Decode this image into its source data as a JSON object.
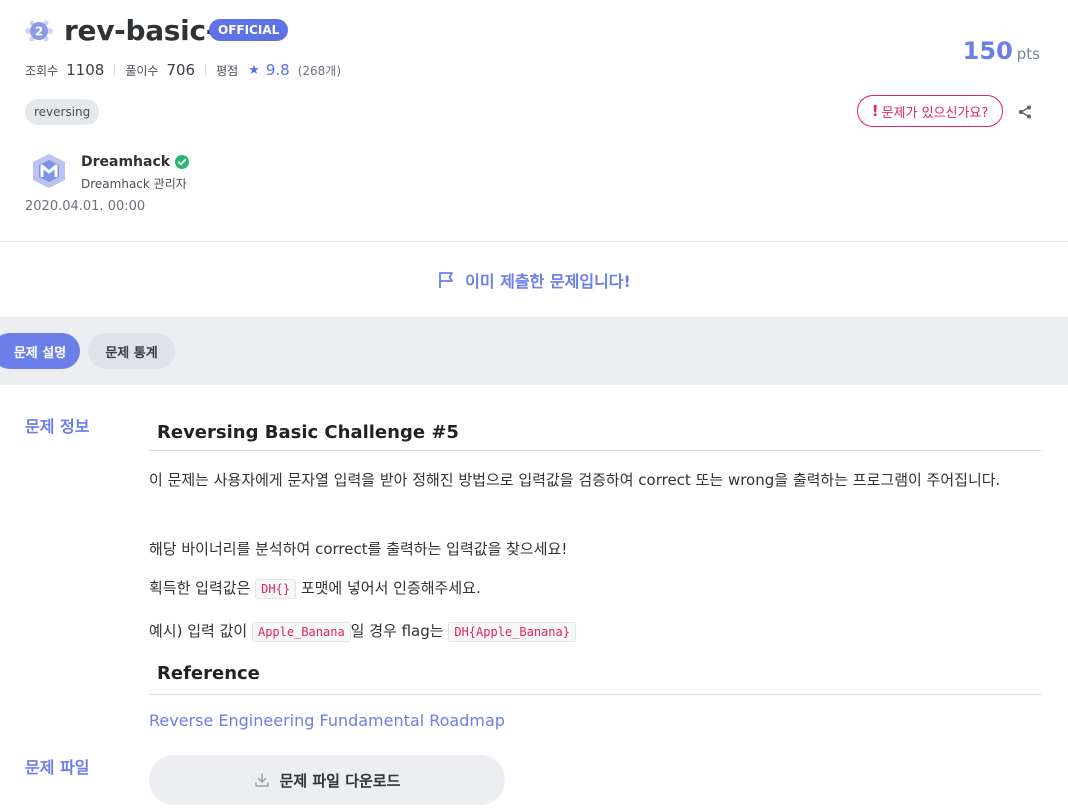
{
  "header": {
    "title": "rev-basic-5",
    "official_badge": "OFFICIAL",
    "level": "2",
    "points": "150",
    "points_unit": "pts"
  },
  "stats": {
    "views_label": "조회수",
    "views": "1108",
    "solves_label": "풀이수",
    "solves": "706",
    "rating_label": "평점",
    "rating": "9.8",
    "rating_count": "(268개)"
  },
  "tags": [
    "reversing"
  ],
  "actions": {
    "report_label": "문제가 있으신가요?"
  },
  "author": {
    "name": "Dreamhack",
    "role": "Dreamhack 관리자",
    "created_at": "2020.04.01. 00:00"
  },
  "status": {
    "submitted_text": "이미 제출한 문제입니다!"
  },
  "tabs": [
    {
      "label": "문제 설명",
      "active": true
    },
    {
      "label": "문제 통계",
      "active": false
    }
  ],
  "sections": {
    "info_label": "문제 정보",
    "files_label": "문제 파일"
  },
  "content": {
    "heading": "Reversing Basic Challenge #5",
    "para1": "이 문제는 사용자에게 문자열 입력을 받아 정해진 방법으로 입력값을 검증하여 correct 또는 wrong을 출력하는 프로그램이 주어집니다.",
    "para2": "해당 바이너리를 분석하여 correct를 출력하는 입력값을 찾으세요!",
    "para3_pre": "획득한 입력값은 ",
    "para3_code": "DH{}",
    "para3_post": " 포맷에 넣어서 인증해주세요.",
    "para4_pre": "예시) 입력 값이 ",
    "para4_code1": "Apple_Banana",
    "para4_mid": "일 경우 flag는 ",
    "para4_code2": "DH{Apple_Banana}",
    "reference_heading": "Reference",
    "reference_link": "Reverse Engineering Fundamental Roadmap"
  },
  "download": {
    "label": "문제 파일 다운로드"
  },
  "colors": {
    "accent": "#6b7ee9",
    "danger": "#e0245e",
    "verified": "#2bb673"
  }
}
